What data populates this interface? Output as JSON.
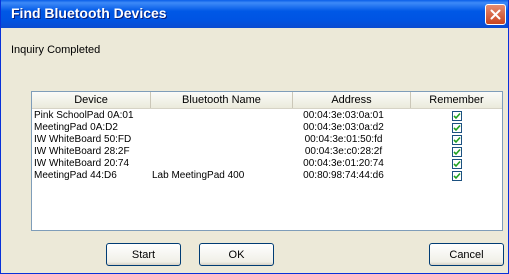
{
  "window": {
    "title": "Find Bluetooth Devices"
  },
  "status_text": "Inquiry Completed",
  "table": {
    "columns": [
      "Device",
      "Bluetooth Name",
      "Address",
      "Remember"
    ],
    "rows": [
      {
        "device": "Pink SchoolPad 0A:01",
        "name": "",
        "address": "00:04:3e:03:0a:01",
        "remember": true
      },
      {
        "device": "MeetingPad 0A:D2",
        "name": "",
        "address": "00:04:3e:03:0a:d2",
        "remember": true
      },
      {
        "device": "IW WhiteBoard 50:FD",
        "name": "",
        "address": "00:04:3e:01:50:fd",
        "remember": true
      },
      {
        "device": "IW WhiteBoard 28:2F",
        "name": "",
        "address": "00:04:3e:c0:28:2f",
        "remember": true
      },
      {
        "device": "IW WhiteBoard 20:74",
        "name": "",
        "address": "00:04:3e:01:20:74",
        "remember": true
      },
      {
        "device": "MeetingPad 44:D6",
        "name": "Lab MeetingPad 400",
        "address": "00:80:98:74:44:d6",
        "remember": true
      }
    ]
  },
  "buttons": {
    "start": "Start",
    "ok": "OK",
    "cancel": "Cancel"
  },
  "icons": {
    "close": "close-icon",
    "check": "checkmark-icon"
  }
}
